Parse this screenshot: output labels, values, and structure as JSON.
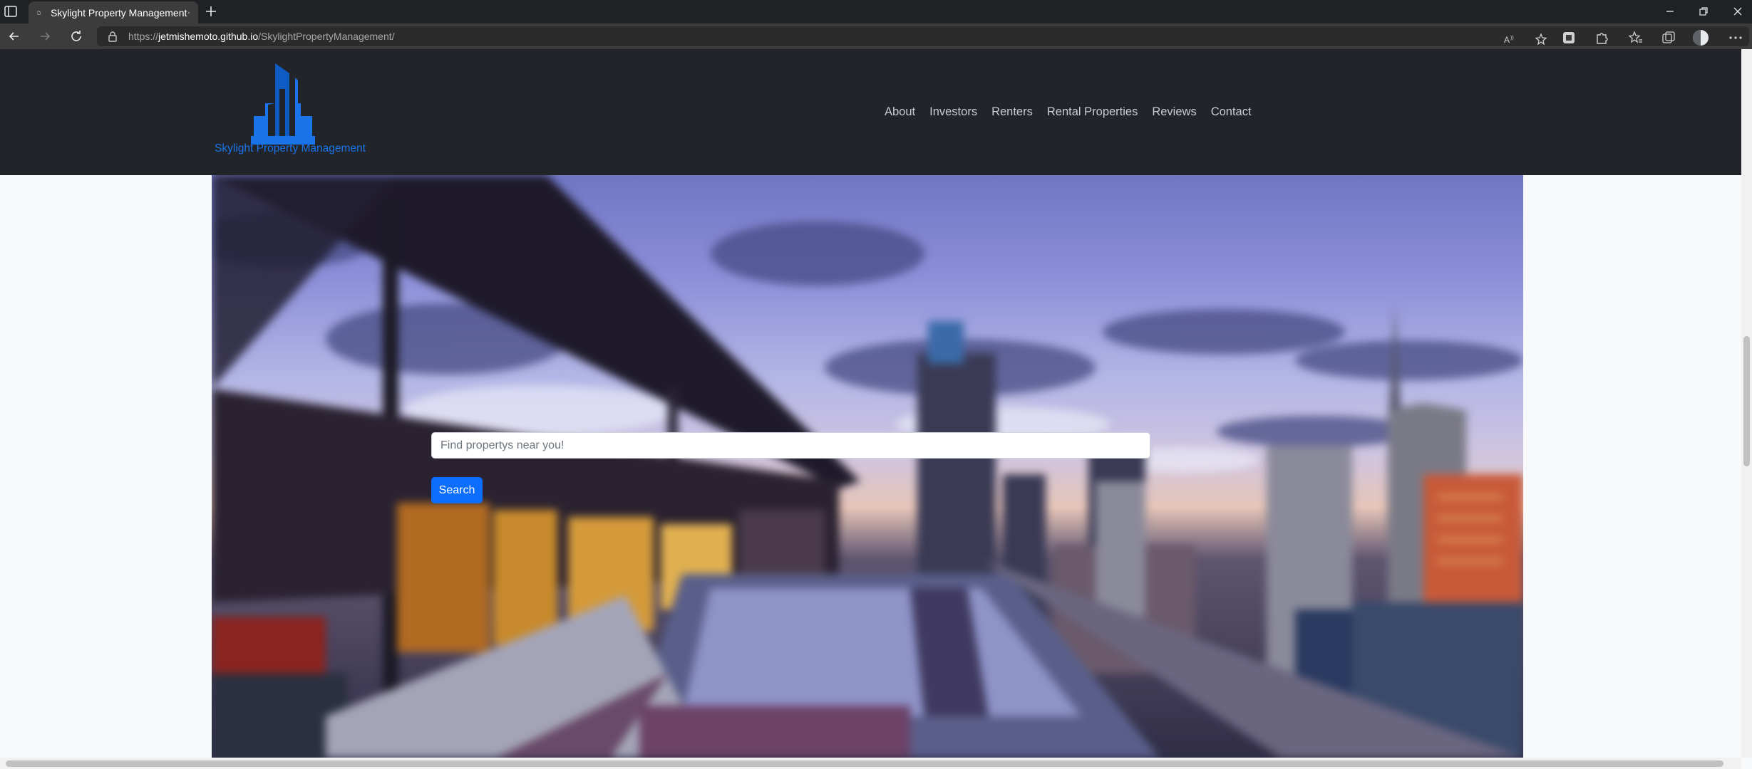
{
  "browser": {
    "tab_title": "Skylight Property Management",
    "url_scheme": "https://",
    "url_host": "jetmishemoto.github.io",
    "url_path": "/SkylightPropertyManagement/"
  },
  "site": {
    "logo_text": "Skylight Property Management",
    "nav": [
      "About",
      "Investors",
      "Renters",
      "Rental Properties",
      "Reviews",
      "Contact"
    ]
  },
  "hero": {
    "search_placeholder": "Find propertys near you!",
    "search_button": "Search"
  },
  "colors": {
    "brand_blue": "#1a73e8",
    "button_blue": "#0d6efd",
    "navbar_bg": "#212529"
  }
}
